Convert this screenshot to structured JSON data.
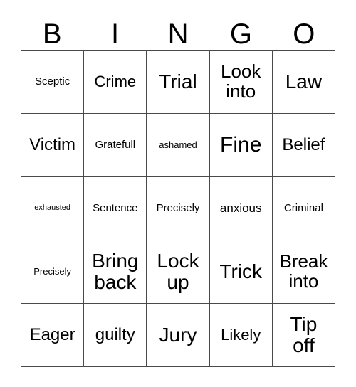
{
  "card": {
    "title": "BINGO",
    "header": {
      "letters": [
        "B",
        "I",
        "N",
        "G",
        "O"
      ]
    },
    "grid": {
      "columns": 5,
      "rows": 5,
      "border_color": "#4a4a4a",
      "background_color": "#ffffff",
      "text_color": "#000000",
      "cells": [
        [
          {
            "text": "Sceptic",
            "size": "fs-md"
          },
          {
            "text": "Crime",
            "size": "fs-xl"
          },
          {
            "text": "Trial",
            "size": "fs-4xl"
          },
          {
            "text": "Look\ninto",
            "size": "fs-3xl"
          },
          {
            "text": "Law",
            "size": "fs-4xl"
          }
        ],
        [
          {
            "text": "Victim",
            "size": "fs-2xl"
          },
          {
            "text": "Gratefull",
            "size": "fs-md"
          },
          {
            "text": "ashamed",
            "size": "fs-sm"
          },
          {
            "text": "Fine",
            "size": "fs-5xl"
          },
          {
            "text": "Belief",
            "size": "fs-2xl"
          }
        ],
        [
          {
            "text": "exhausted",
            "size": "fs-xs"
          },
          {
            "text": "Sentence",
            "size": "fs-md"
          },
          {
            "text": "Precisely",
            "size": "fs-md"
          },
          {
            "text": "anxious",
            "size": "fs-lg"
          },
          {
            "text": "Criminal",
            "size": "fs-md"
          }
        ],
        [
          {
            "text": "Precisely",
            "size": "fs-sm"
          },
          {
            "text": "Bring\nback",
            "size": "fs-4xl"
          },
          {
            "text": "Lock\nup",
            "size": "fs-4xl"
          },
          {
            "text": "Trick",
            "size": "fs-4xl"
          },
          {
            "text": "Break\ninto",
            "size": "fs-3xl"
          }
        ],
        [
          {
            "text": "Eager",
            "size": "fs-2xl"
          },
          {
            "text": "guilty",
            "size": "fs-2xl"
          },
          {
            "text": "Jury",
            "size": "fs-4xl"
          },
          {
            "text": "Likely",
            "size": "fs-xl"
          },
          {
            "text": "Tip\noff",
            "size": "fs-4xl"
          }
        ]
      ]
    }
  }
}
